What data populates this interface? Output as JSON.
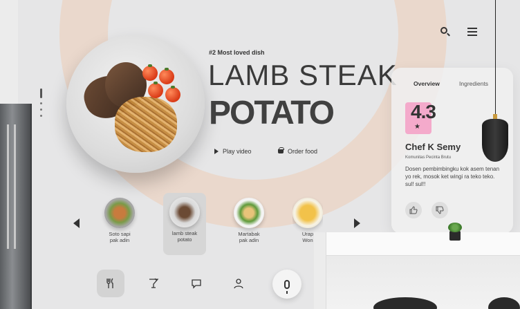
{
  "header": {
    "eyebrow": "#2 Most loved dish",
    "title_line1": "LAMB STEAK",
    "title_line2": "POTATO"
  },
  "actions": {
    "play_label": "Play video",
    "order_label": "Order food"
  },
  "top_icons": [
    "search-icon",
    "menu-icon"
  ],
  "dishes": [
    {
      "label_line1": "Soto sapi",
      "label_line2": "pak adin",
      "active": false
    },
    {
      "label_line1": "lamb steak",
      "label_line2": "potato",
      "active": true
    },
    {
      "label_line1": "Martabak",
      "label_line2": "pak adin",
      "active": false
    },
    {
      "label_line1": "Urap",
      "label_line2": "Won",
      "active": false
    }
  ],
  "bottom_nav": [
    "utensils-icon",
    "cocktail-icon",
    "chat-icon",
    "user-icon"
  ],
  "mic": "microphone-icon",
  "card": {
    "tabs": [
      "Overview",
      "Ingredients"
    ],
    "active_tab": "Overview",
    "rating": "4.3",
    "rating_icon": "star-icon",
    "chef_name": "Chef K Semy",
    "chef_subtitle": "Komunitas Pecinta Brutu",
    "description": "Dosen pembimbingku kok asem tenan yo rek, mosok ket wingi ra teko teko. sul! sul!!",
    "feedback_icons": [
      "thumbs-up-icon",
      "thumbs-down-icon"
    ]
  },
  "colors": {
    "accent_pink": "#f4aacb",
    "arc_peach": "#f0c8aa"
  }
}
